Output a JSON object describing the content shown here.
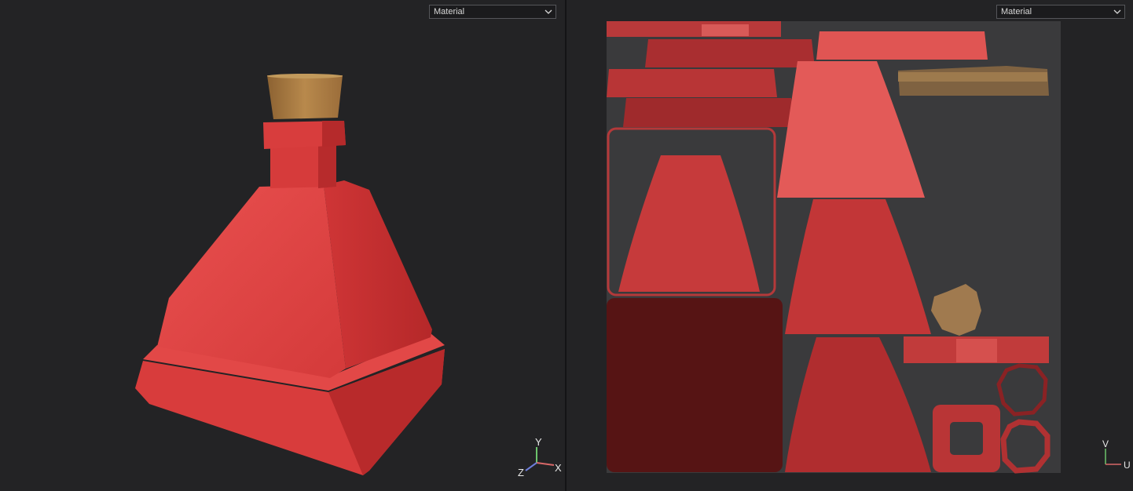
{
  "viewport3d": {
    "view_mode": "Material",
    "gizmo": {
      "x_label": "X",
      "y_label": "Y",
      "z_label": "Z"
    }
  },
  "viewport_uv": {
    "view_mode": "Material",
    "gizmo": {
      "u_label": "U",
      "v_label": "V"
    }
  },
  "colors": {
    "background": "#232325",
    "uv_canvas": "#3a3a3c",
    "bottle_red": "#e0403f",
    "dark_red": "#5a1414",
    "cork": "#a6783f",
    "axis_x": "#d86868",
    "axis_y": "#6cc46c",
    "axis_z": "#6c7cd8"
  }
}
